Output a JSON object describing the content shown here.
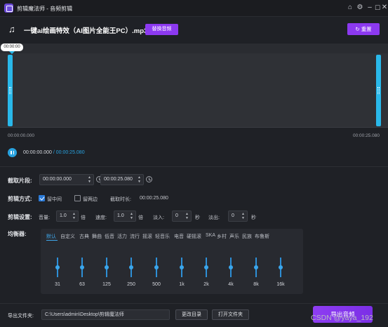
{
  "app": {
    "title": "剪辑魔法师 - 音频剪辑"
  },
  "header": {
    "file_name": "一键ai绘画特效（AI图片全能王PC）.mp3",
    "switch_label": "替换音频",
    "reset_label": "重置"
  },
  "waveform": {
    "playhead_time": "00:00:00",
    "start_label": "00:00:00.000",
    "end_label": "00:00:25.080"
  },
  "playback": {
    "current": "00:00:00.000",
    "separator": " / ",
    "total": "00:00:25.080"
  },
  "clip": {
    "label": "截取片段:",
    "start": "00:00:00.000",
    "end": "00:00:25.080"
  },
  "mode": {
    "label": "剪辑方式:",
    "keep_middle": "留中间",
    "keep_middle_checked": true,
    "keep_sides": "留两边",
    "keep_sides_checked": false,
    "duration_label": "截取时长:",
    "duration": "00:00:25.080"
  },
  "settings": {
    "label": "剪辑设置:",
    "volume_label": "音量:",
    "volume": "1.0",
    "volume_unit": "倍",
    "speed_label": "速度:",
    "speed": "1.0",
    "speed_unit": "倍",
    "fade_in_label": "淡入:",
    "fade_in": "0",
    "fade_in_unit": "秒",
    "fade_out_label": "淡出:",
    "fade_out": "0",
    "fade_out_unit": "秒"
  },
  "equalizer": {
    "label": "均衡器:",
    "tabs": [
      "默认",
      "自定义",
      "古典",
      "舞曲",
      "低音",
      "活力",
      "流行",
      "摇滚",
      "轻音乐",
      "电音",
      "硬摇滚",
      "SKA",
      "乡村",
      "声乐",
      "民族",
      "布鲁斯"
    ],
    "active_tab": "默认",
    "bands": [
      "31",
      "63",
      "125",
      "250",
      "500",
      "1k",
      "2k",
      "4k",
      "8k",
      "16k"
    ],
    "levels": [
      0,
      0,
      0,
      0,
      0,
      0,
      0,
      0,
      0,
      0
    ]
  },
  "footer": {
    "folder_label": "导出文件夹:",
    "folder_path": "C:\\Users\\admin\\Desktop\\剪辑魔法师",
    "change_dir": "更改目录",
    "open_folder": "打开文件夹",
    "export_label": "导出音频",
    "watermark": "CSDN @yaya_192"
  },
  "colors": {
    "accent_purple": "#8c39f0",
    "accent_blue": "#29a3e0",
    "background": "#1f2126"
  },
  "icons": [
    "app-logo-icon",
    "home-icon",
    "settings-icon",
    "minimize-icon",
    "maximize-icon",
    "close-icon",
    "music-note-icon",
    "reset-icon",
    "pause-icon",
    "clock-icon",
    "spinner-arrows-icon"
  ]
}
